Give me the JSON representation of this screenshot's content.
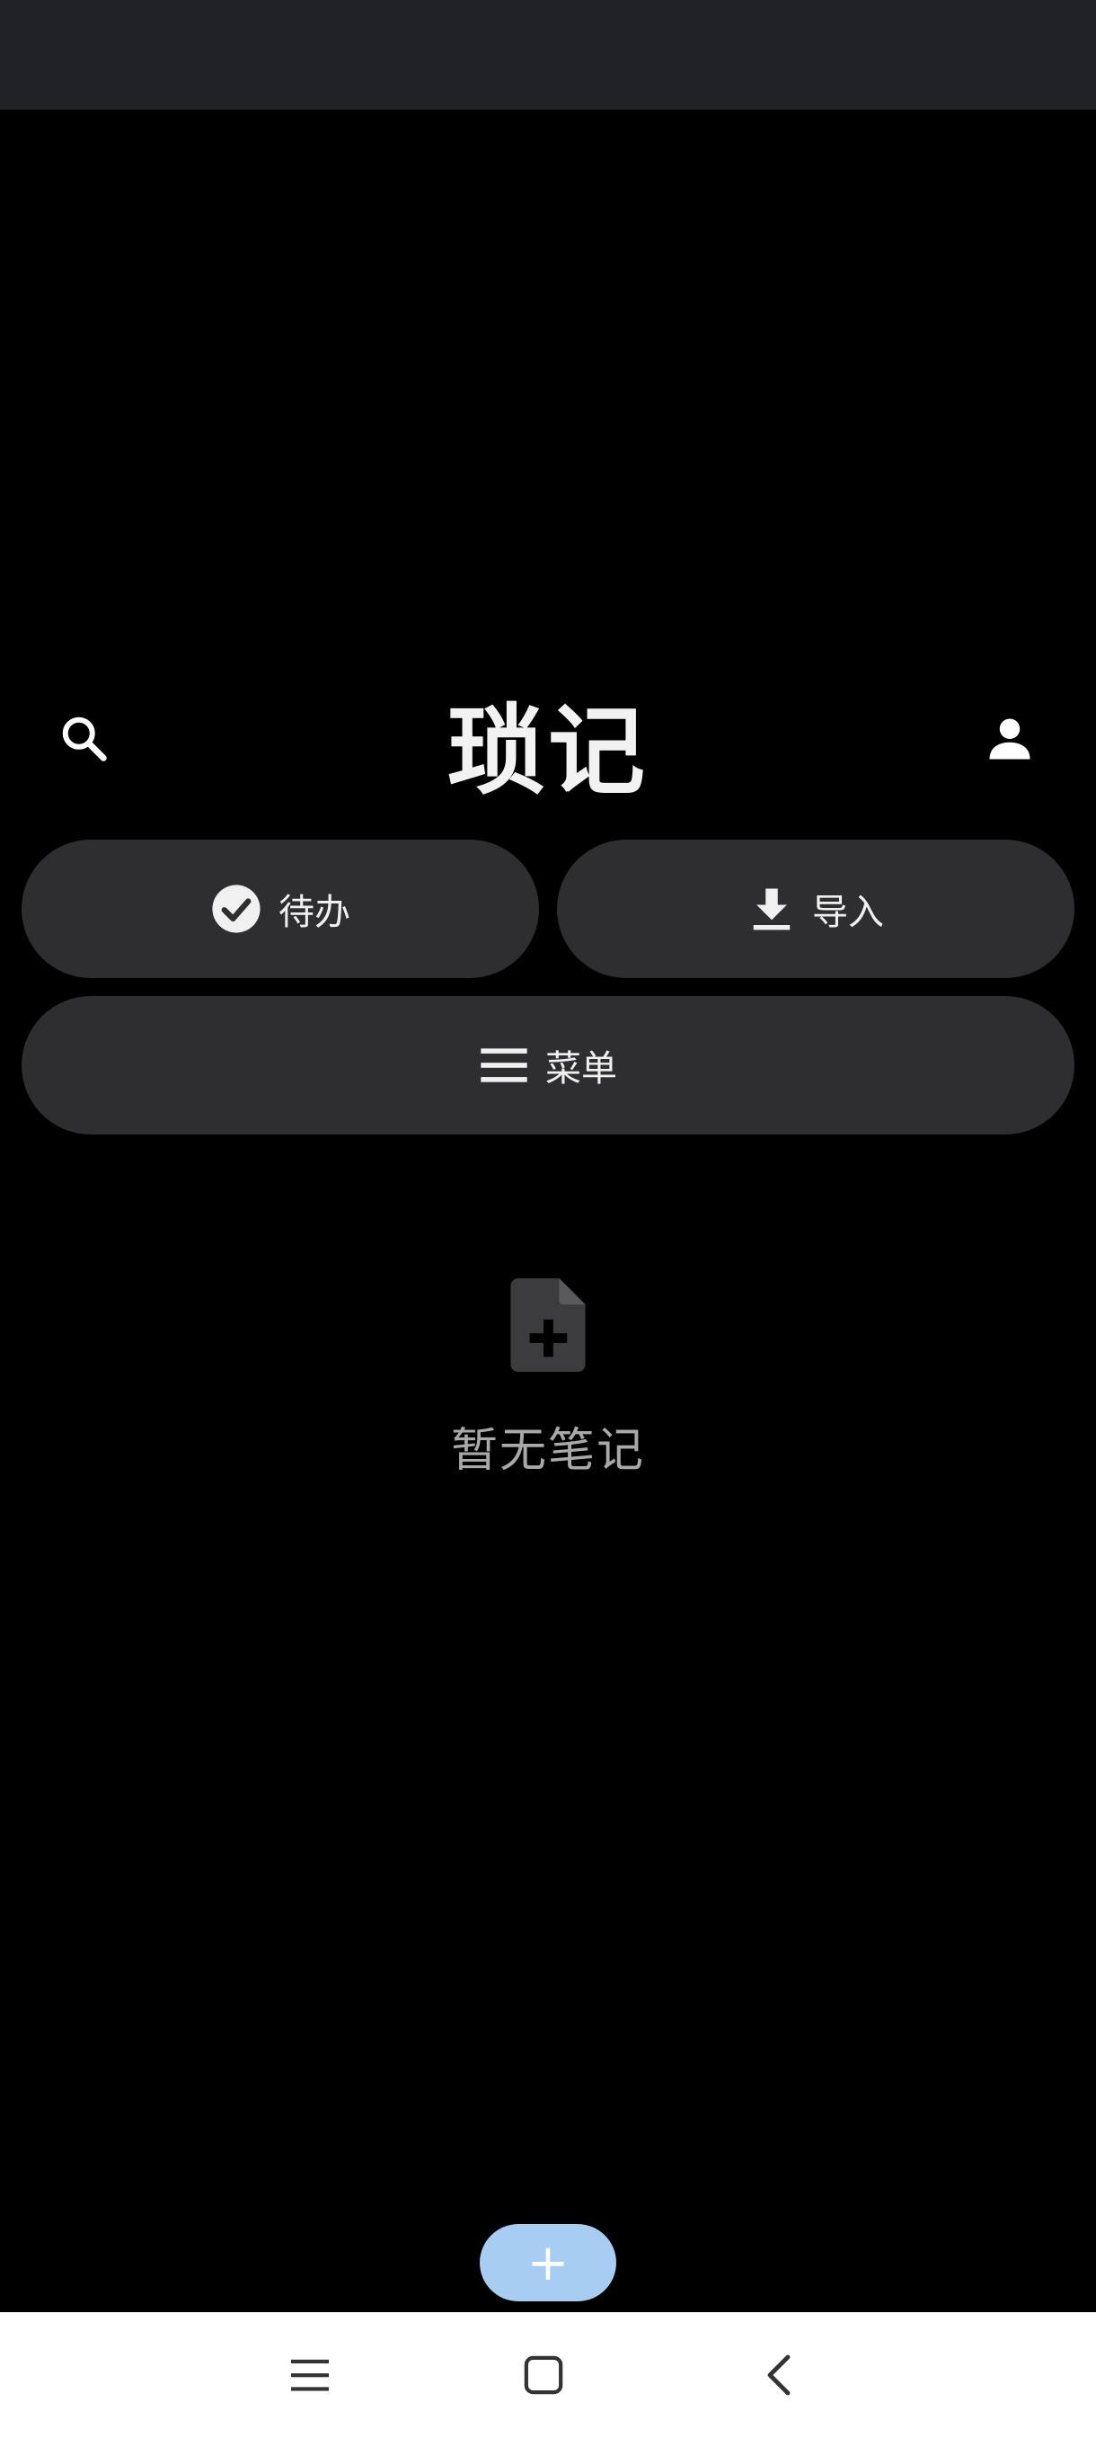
{
  "app": {
    "title": "琐记"
  },
  "header": {
    "search_icon": "search-icon",
    "profile_icon": "person-icon"
  },
  "actions": {
    "todo_label": "待办",
    "todo_icon": "check-circle-icon",
    "import_label": "导入",
    "import_icon": "download-icon",
    "menu_label": "菜单",
    "menu_icon": "hamburger-menu-icon"
  },
  "empty_state": {
    "icon": "note-add-icon",
    "text": "暂无笔记"
  },
  "fab": {
    "label": "+"
  },
  "navigation": {
    "menu_icon": "recents-icon",
    "home_icon": "home-icon",
    "back_icon": "back-icon"
  },
  "colors": {
    "background": "#000000",
    "status_bar": "#212226",
    "pill": "#2e2e31",
    "fab": "#a7cdf3",
    "empty_text": "#a9a9a9",
    "nav_bar": "#ffffff"
  }
}
